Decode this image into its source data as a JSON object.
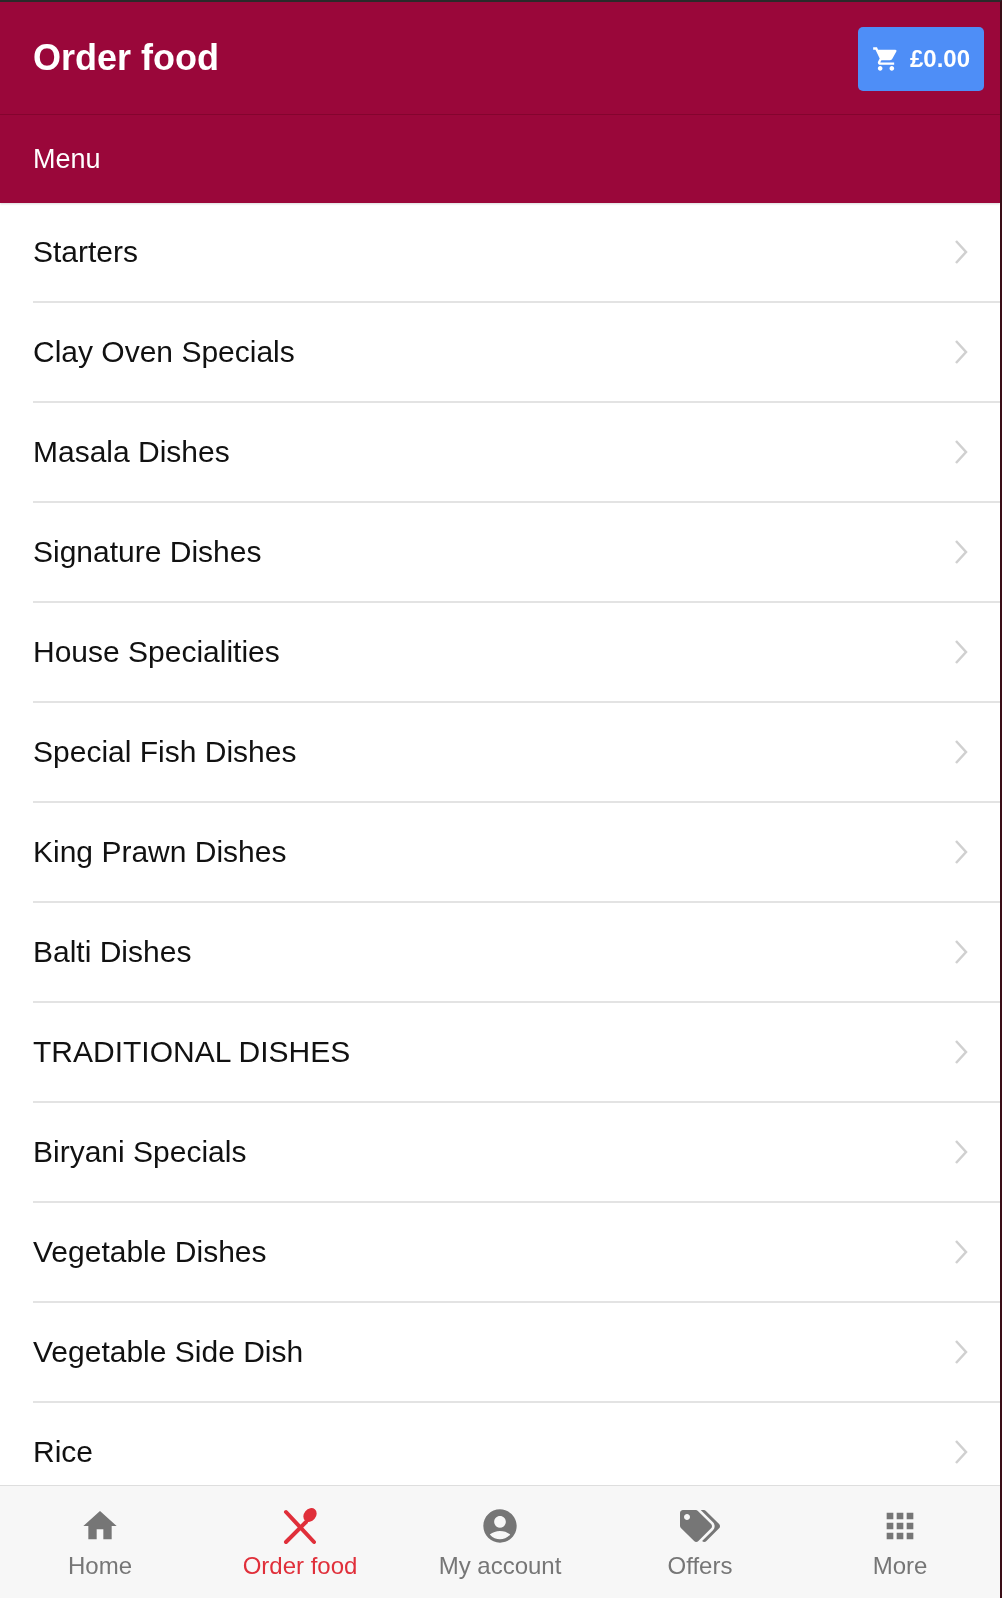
{
  "header": {
    "title": "Order food",
    "cart": {
      "total": "£0.00"
    }
  },
  "subheader": {
    "title": "Menu"
  },
  "menu": {
    "items": [
      {
        "label": "Starters"
      },
      {
        "label": "Clay Oven Specials"
      },
      {
        "label": "Masala Dishes"
      },
      {
        "label": "Signature Dishes"
      },
      {
        "label": "House Specialities"
      },
      {
        "label": "Special Fish Dishes"
      },
      {
        "label": "King Prawn Dishes"
      },
      {
        "label": "Balti Dishes"
      },
      {
        "label": "TRADITIONAL DISHES"
      },
      {
        "label": "Biryani Specials"
      },
      {
        "label": "Vegetable Dishes"
      },
      {
        "label": "Vegetable Side Dish"
      },
      {
        "label": "Rice"
      }
    ]
  },
  "bottom_nav": {
    "items": [
      {
        "label": "Home",
        "selected": false
      },
      {
        "label": "Order food",
        "selected": true
      },
      {
        "label": "My account",
        "selected": false
      },
      {
        "label": "Offers",
        "selected": false
      },
      {
        "label": "More",
        "selected": false
      }
    ]
  }
}
